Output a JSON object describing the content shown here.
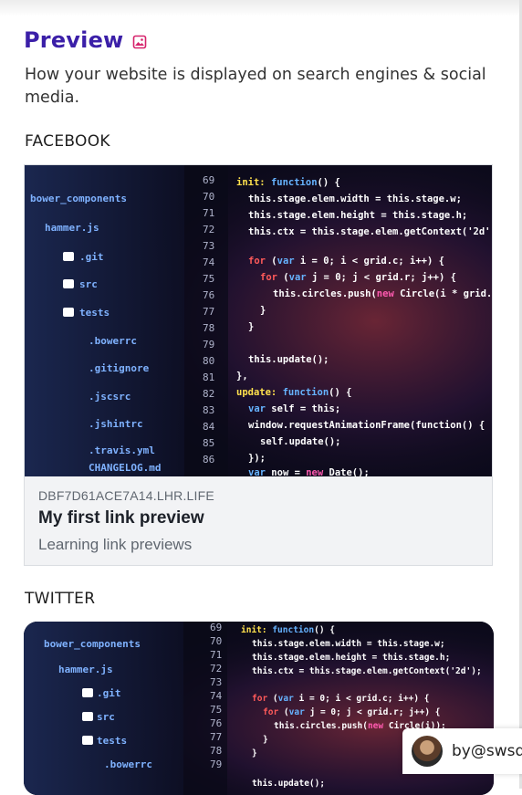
{
  "heading": {
    "title": "Preview",
    "icon": "image-icon",
    "accent": "#3b1fa8"
  },
  "subtitle": "How your website is displayed on search engines & social media.",
  "facebook": {
    "label": "FACEBOOK",
    "domain": "DBF7D61ACE7A14.LHR.LIFE",
    "title": "My first link preview",
    "description": "Learning link previews"
  },
  "twitter": {
    "label": "TWITTER"
  },
  "badge": {
    "text": "by@swsd"
  }
}
